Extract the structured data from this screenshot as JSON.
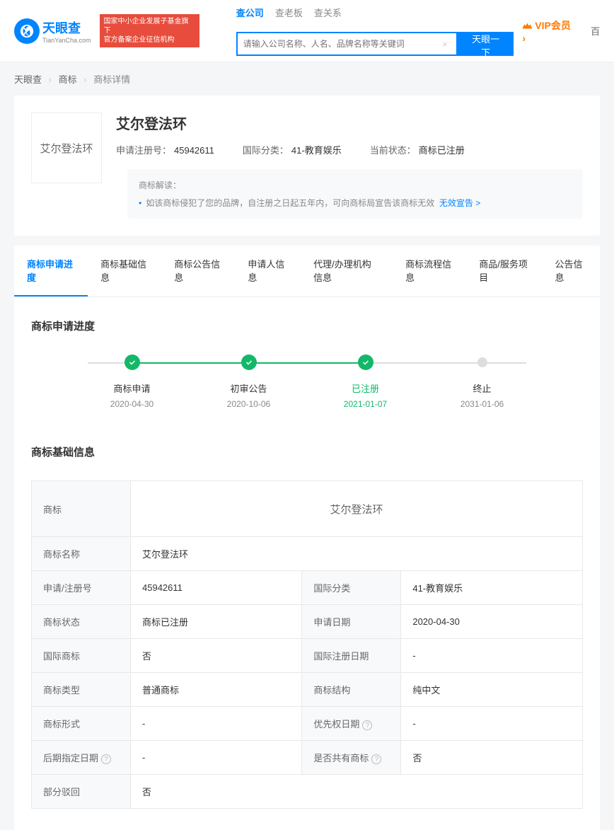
{
  "header": {
    "logo_main": "天眼查",
    "logo_sub": "TianYanCha.com",
    "red_badge_line1": "国家中小企业发展子基金旗下",
    "red_badge_line2": "官方备案企业征信机构",
    "search_tabs": [
      "查公司",
      "查老板",
      "查关系"
    ],
    "search_placeholder": "请输入公司名称、人名、品牌名称等关键词",
    "search_btn": "天眼一下",
    "vip": "VIP会员",
    "extra": "百"
  },
  "breadcrumb": {
    "items": [
      "天眼查",
      "商标",
      "商标详情"
    ]
  },
  "trademark": {
    "img_text": "艾尔登法环",
    "title": "艾尔登法环",
    "reg_no_label": "申请注册号：",
    "reg_no": "45942611",
    "class_label": "国际分类：",
    "class": "41-教育娱乐",
    "status_label": "当前状态：",
    "status": "商标已注册",
    "note_title": "商标解读：",
    "note_body": "如该商标侵犯了您的品牌，自注册之日起五年内，可向商标局宣告该商标无效",
    "note_link": "无效宣告 >"
  },
  "tabs": [
    "商标申请进度",
    "商标基础信息",
    "商标公告信息",
    "申请人信息",
    "代理/办理机构信息",
    "商标流程信息",
    "商品/服务项目",
    "公告信息"
  ],
  "progress": {
    "title": "商标申请进度",
    "steps": [
      {
        "label": "商标申请",
        "date": "2020-04-30",
        "state": "done"
      },
      {
        "label": "初审公告",
        "date": "2020-10-06",
        "state": "done"
      },
      {
        "label": "已注册",
        "date": "2021-01-07",
        "state": "current"
      },
      {
        "label": "终止",
        "date": "2031-01-06",
        "state": "todo"
      }
    ]
  },
  "basic": {
    "title": "商标基础信息",
    "rows": [
      [
        {
          "label": "商标",
          "value_img": "艾尔登法环",
          "span": 3
        }
      ],
      [
        {
          "label": "商标名称",
          "value": "艾尔登法环",
          "span": 3
        }
      ],
      [
        {
          "label": "申请/注册号",
          "value": "45942611"
        },
        {
          "label": "国际分类",
          "value": "41-教育娱乐"
        }
      ],
      [
        {
          "label": "商标状态",
          "value": "商标已注册"
        },
        {
          "label": "申请日期",
          "value": "2020-04-30"
        }
      ],
      [
        {
          "label": "国际商标",
          "value": "否"
        },
        {
          "label": "国际注册日期",
          "value": "-"
        }
      ],
      [
        {
          "label": "商标类型",
          "value": "普通商标"
        },
        {
          "label": "商标结构",
          "value": "纯中文"
        }
      ],
      [
        {
          "label": "商标形式",
          "value": "-"
        },
        {
          "label": "优先权日期",
          "value": "-",
          "help": true
        }
      ],
      [
        {
          "label": "后期指定日期",
          "value": "-",
          "help": true
        },
        {
          "label": "是否共有商标",
          "value": "否",
          "help": true
        }
      ],
      [
        {
          "label": "部分驳回",
          "value": "否",
          "span": 3
        }
      ]
    ]
  }
}
